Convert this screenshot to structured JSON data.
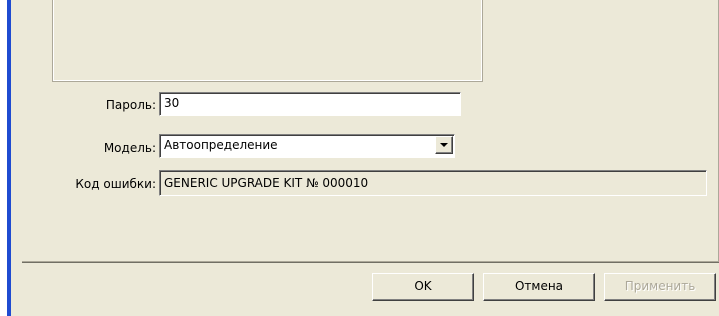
{
  "form": {
    "password_label": "Пароль:",
    "password_value": "30",
    "model_label": "Модель:",
    "model_value": "Автоопределение",
    "error_code_label": "Код ошибки:",
    "error_code_value": "GENERIC UPGRADE KIT № 000010"
  },
  "buttons": {
    "ok": "OK",
    "cancel": "Отмена",
    "apply": "Применить"
  },
  "colors": {
    "window_border": "#1f4bd1",
    "dialog_face": "#ece9d8",
    "disabled_text": "#aca899"
  }
}
